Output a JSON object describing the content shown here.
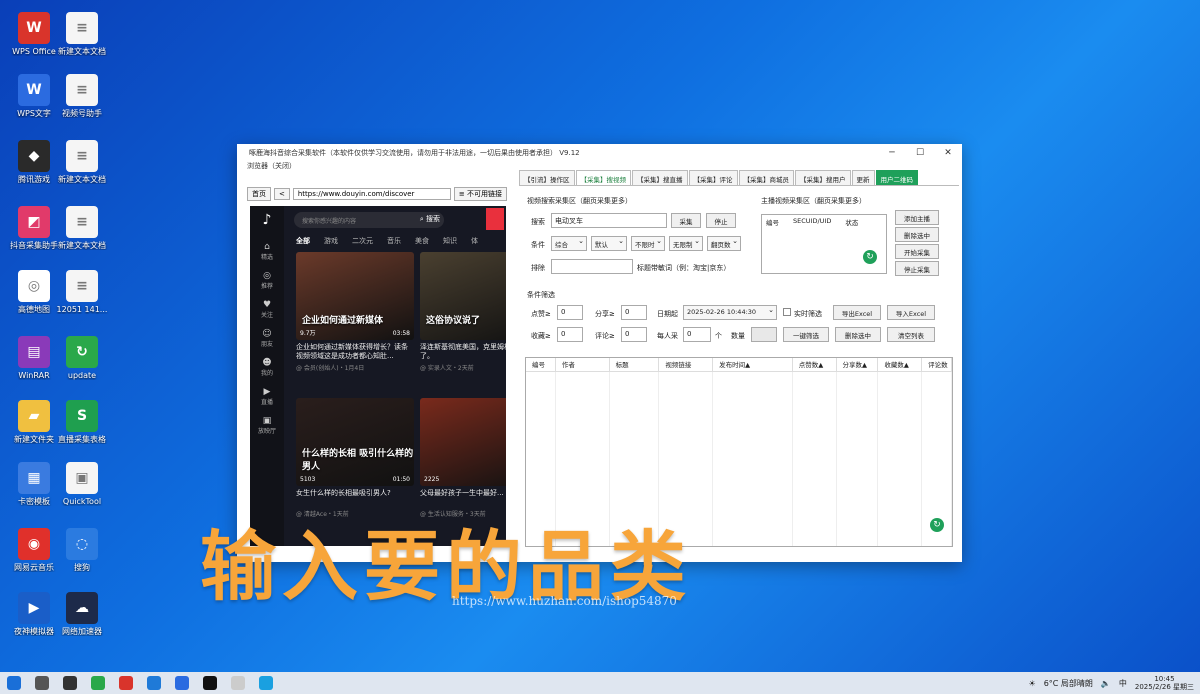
{
  "desktop": {
    "icons": [
      {
        "label": "WPS Office",
        "color": "#d9342b",
        "glyph": "W"
      },
      {
        "label": "新建文本文档",
        "color": "#f5f5f5",
        "glyph": "≡"
      },
      {
        "label": "WPS文字",
        "color": "#2b6be0",
        "glyph": "W"
      },
      {
        "label": "视频号助手",
        "color": "#f5f5f5",
        "glyph": "≡"
      },
      {
        "label": "腾讯游戏",
        "color": "#2a2a2a",
        "glyph": "◆"
      },
      {
        "label": "新建文本文档",
        "color": "#f5f5f5",
        "glyph": "≡"
      },
      {
        "label": "抖音采集助手",
        "color": "#e13a6a",
        "glyph": "◩"
      },
      {
        "label": "新建文本文档",
        "color": "#f5f5f5",
        "glyph": "≡"
      },
      {
        "label": "高德地图",
        "color": "#ffffff",
        "glyph": "◎"
      },
      {
        "label": "12051 141...",
        "color": "#f5f5f5",
        "glyph": "≡"
      },
      {
        "label": "WinRAR",
        "color": "#8a3ab9",
        "glyph": "▤"
      },
      {
        "label": "update",
        "color": "#2aa84a",
        "glyph": "↻"
      },
      {
        "label": "新建文件夹",
        "color": "#f0c040",
        "glyph": "▰"
      },
      {
        "label": "直播采集表格",
        "color": "#1f9f4f",
        "glyph": "S"
      },
      {
        "label": "卡密模板",
        "color": "#3a7be0",
        "glyph": "▦"
      },
      {
        "label": "QuickTool",
        "color": "#f5f5f5",
        "glyph": "▣"
      },
      {
        "label": "网易云音乐",
        "color": "#e0302b",
        "glyph": "◉"
      },
      {
        "label": "搜狗",
        "color": "#2b7be0",
        "glyph": "◌"
      },
      {
        "label": "夜神模拟器",
        "color": "#1a5ec8",
        "glyph": "▶"
      },
      {
        "label": "网络加速器",
        "color": "#1d2a4a",
        "glyph": "☁"
      }
    ]
  },
  "app": {
    "title": "啄鹿海抖音综合采集软件（本软件仅供学习交流使用，请勿用于非法用途，一切后果由使用者承担） V9.12",
    "menu": "浏览器（关闭）",
    "browser": {
      "back": "首页",
      "prev": "<",
      "url": "https://www.douyin.com/discover",
      "btn": "≡ 不可用链接"
    },
    "douyin": {
      "search_placeholder": "搜索你感兴趣的内容",
      "search_btn": "搜索",
      "tabs": [
        "全部",
        "游戏",
        "二次元",
        "音乐",
        "美食",
        "知识",
        "体"
      ],
      "side": [
        "精选",
        "推荐",
        "关注",
        "朋友",
        "我的",
        "直播",
        "放映厅"
      ],
      "cards": [
        {
          "overlay": "企业如何通过新媒体",
          "caption": "企业如何通过新媒体获得增长？读条视频领域这是成功者都心知肚...",
          "meta": "@ 会员(创始人)・1月4日",
          "stat": "9.7万",
          "dur": "03:58",
          "color": "#6b3a2a"
        },
        {
          "overlay": "这俗协议说了",
          "caption": "泽连斯基彻底美国，克里姆林宫卖了。",
          "meta": "@ 实录人文・2天前",
          "stat": "",
          "dur": "",
          "color": "#4a4030"
        },
        {
          "overlay": "什么样的长相 吸引什么样的男人",
          "caption": "女生什么样的长相最吸引男人?",
          "meta": "@ 清越Ace・1天前",
          "stat": "5103",
          "dur": "01:50",
          "color": "#2a1e1c"
        },
        {
          "overlay": "",
          "caption": "父母最好孩子一生中最好...",
          "meta": "@ 生活认知服务・3天前",
          "stat": "2225",
          "dur": "",
          "color": "#7a2a1c"
        }
      ]
    },
    "tabs": [
      "【引流】操作区",
      "【采集】搜视频",
      "【采集】搜直播",
      "【采集】评论",
      "【采集】商城员",
      "【采集】搜用户",
      "更新",
      "用户二维码"
    ],
    "video_section": "视频搜索采集区（翻页采集更多）",
    "search_label": "搜索",
    "search_value": "电动叉车",
    "collect_btn": "采集",
    "stop_btn": "停止",
    "cond_label": "条件",
    "cond_selects": [
      "综合",
      "默认",
      "不限时",
      "无限制",
      "翻页数"
    ],
    "sort_label": "排除",
    "sort_hint": "标题带敏词（例：淘宝|京东）",
    "uid_section": "主播视频采集区（翻页采集更多）",
    "uid_headers": [
      "编号",
      "SECUID/UID",
      "状态"
    ],
    "uid_buttons": [
      "添加主播",
      "删除选中",
      "开始采集",
      "停止采集"
    ],
    "filter_section": "条件筛选",
    "filter": {
      "likes_label": "点赞≥",
      "likes": "0",
      "share_label": "分享≥",
      "share": "0",
      "date_label": "日期起",
      "date": "2025-02-26 10:44:30",
      "realtime_label": "实时筛选",
      "export": "导出Excel",
      "import": "导入Excel",
      "collect_label": "收藏≥",
      "collect": "0",
      "comment_label": "评论≥",
      "comment": "0",
      "per_label": "每人采",
      "per": "0",
      "per_unit": "个",
      "count_label": "数量",
      "btn_filter": "一键筛选",
      "btn_delete": "删除选中",
      "btn_clear": "清空列表"
    },
    "grid_headers": [
      "编号",
      "作者",
      "标题",
      "视频链接",
      "发布时间▲",
      "点赞数▲",
      "分享数▲",
      "收藏数▲",
      "评论数"
    ]
  },
  "caption": "输入要的品类",
  "watermark": "https://www.huzhan.com/ishop54870",
  "taskbar": {
    "weather": "6°C 局部晴朗",
    "ime": "中",
    "time": "10:45",
    "date": "2025/2/26 星期三"
  },
  "colors": {
    "desktop": "#0f6fe0",
    "accent_green": "#1fa05a",
    "caption": "#f7a53a"
  }
}
